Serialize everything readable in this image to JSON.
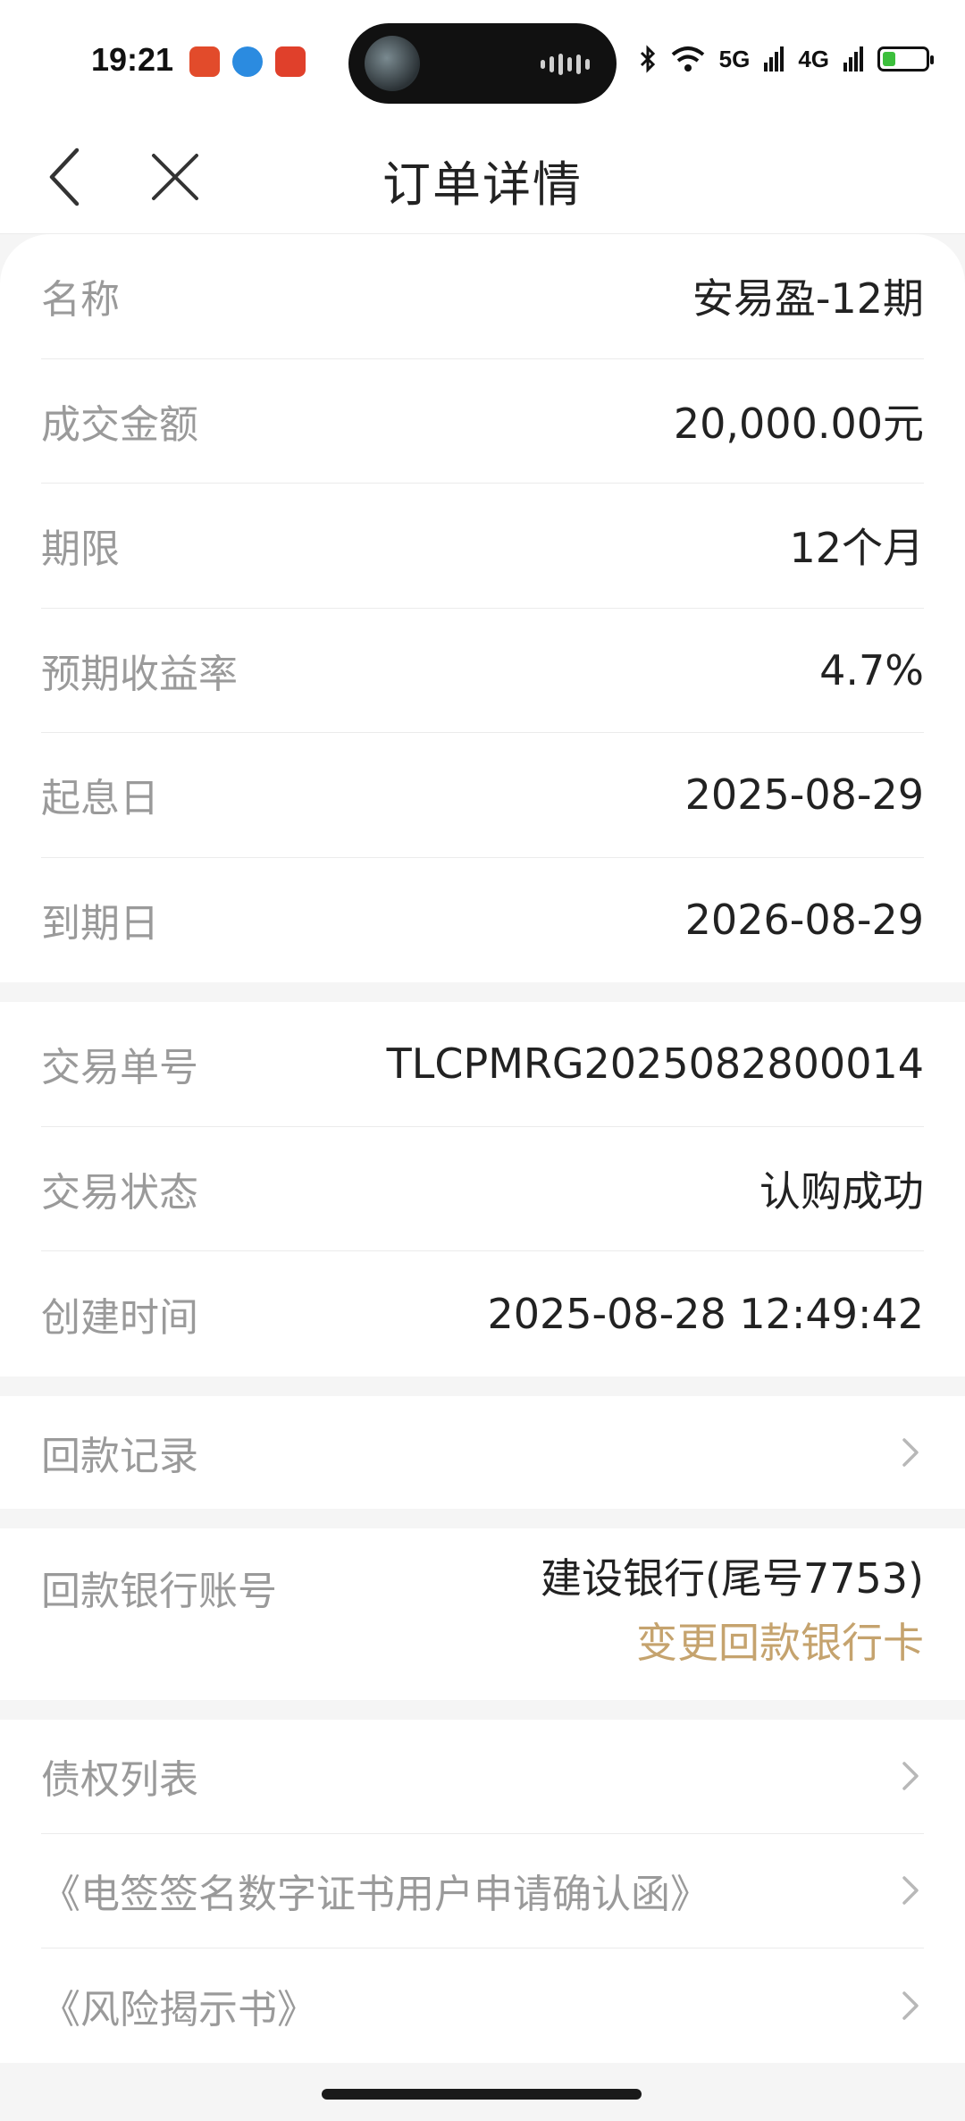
{
  "status_bar": {
    "time": "19:21",
    "signal_5g": "5G",
    "signal_4g": "4G",
    "app_icons": [
      "listen-app-icon",
      "tencent-app-icon",
      "video-app-icon"
    ]
  },
  "nav": {
    "title": "订单详情",
    "back_icon": "chevron-left-icon",
    "close_icon": "close-icon"
  },
  "product": {
    "name_label": "名称",
    "name_value": "安易盈-12期",
    "amount_label": "成交金额",
    "amount_value": "20,000.00元",
    "term_label": "期限",
    "term_value": "12个月",
    "rate_label": "预期收益率",
    "rate_value": "4.7%",
    "start_label": "起息日",
    "start_value": "2025-08-29",
    "end_label": "到期日",
    "end_value": "2026-08-29"
  },
  "transaction": {
    "order_no_label": "交易单号",
    "order_no_value": "TLCPMRG2025082800014",
    "status_label": "交易状态",
    "status_value": "认购成功",
    "created_label": "创建时间",
    "created_value": "2025-08-28 12:49:42"
  },
  "repayment": {
    "records_label": "回款记录"
  },
  "bank": {
    "label": "回款银行账号",
    "account": "建设银行(尾号7753)",
    "change_label": "变更回款银行卡"
  },
  "documents": {
    "items": [
      "债权列表",
      "《电签签名数字证书用户申请确认函》",
      "《风险揭示书》"
    ]
  },
  "colors": {
    "accent_gold": "#c5a36e",
    "background": "#f5f5f5",
    "label_gray": "#9a9a9a",
    "value_dark": "#222222"
  }
}
